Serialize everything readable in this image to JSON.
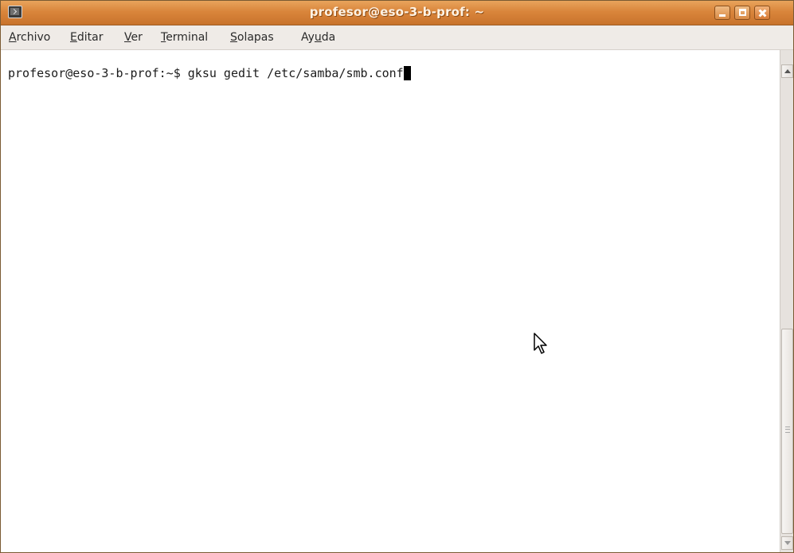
{
  "window": {
    "title": "profesor@eso-3-b-prof: ~",
    "icon": "terminal-icon",
    "buttons": [
      "minimize-icon",
      "maximize-icon",
      "close-icon"
    ]
  },
  "menu": {
    "items": [
      {
        "mnemonic": "A",
        "rest": "rchivo"
      },
      {
        "mnemonic": "E",
        "rest": "ditar"
      },
      {
        "mnemonic": "V",
        "rest": "er"
      },
      {
        "mnemonic": "T",
        "rest": "erminal"
      },
      {
        "mnemonic": "S",
        "rest": "olapas"
      },
      {
        "pre": "Ay",
        "mnemonic": "u",
        "rest": "da"
      }
    ]
  },
  "terminal": {
    "prompt": "profesor@eso-3-b-prof:~$ ",
    "command": "gksu gedit /etc/samba/smb.conf"
  },
  "colors": {
    "titlebar_accent": "#d9853b",
    "menubar_bg": "#efebe7",
    "terminal_bg": "#ffffff",
    "terminal_fg": "#1c1c1c"
  },
  "icons": {
    "pointer": "mouse-pointer-icon"
  }
}
